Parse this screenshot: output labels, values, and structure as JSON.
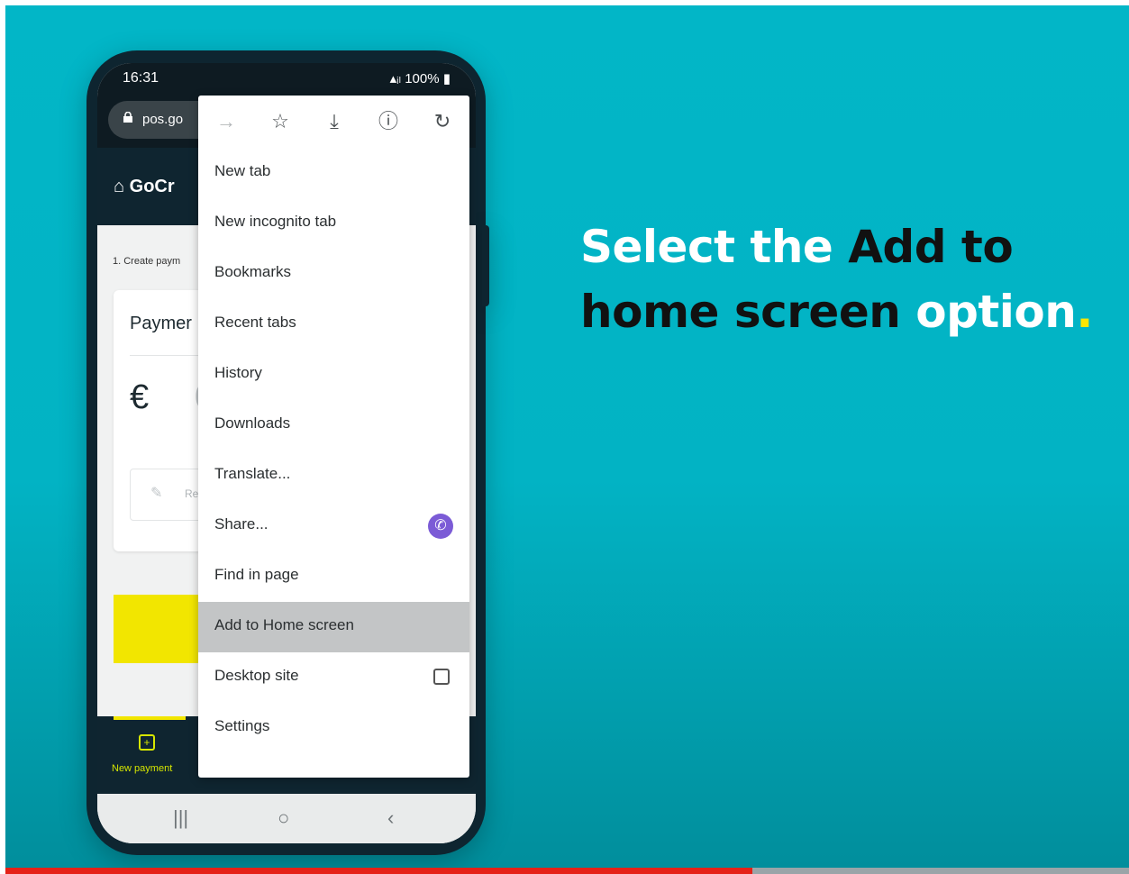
{
  "headline": {
    "part1": "Select the ",
    "part2": "Add to",
    "part3": "home screen ",
    "part4": "option",
    "part5": "."
  },
  "status_bar": {
    "time": "16:31",
    "battery": "100%"
  },
  "url_bar": {
    "text": "pos.go"
  },
  "app": {
    "logo": "GoCr",
    "breadcrumb": "1. Create paym",
    "card_title": "Paymer",
    "currency": "€",
    "amount": "0",
    "reference_hint": "Re",
    "bottom_nav_label": "New payment"
  },
  "menu": {
    "toolbar_icons": [
      "forward-icon",
      "star-icon",
      "download-icon",
      "info-icon",
      "reload-icon"
    ],
    "items": [
      {
        "label": "New tab"
      },
      {
        "label": "New incognito tab"
      },
      {
        "label": "Bookmarks"
      },
      {
        "label": "Recent tabs"
      },
      {
        "label": "History"
      },
      {
        "label": "Downloads"
      },
      {
        "label": "Translate..."
      },
      {
        "label": "Share..."
      },
      {
        "label": "Find in page"
      },
      {
        "label": "Add to Home screen"
      },
      {
        "label": "Desktop site"
      },
      {
        "label": "Settings"
      }
    ],
    "highlighted": "Add to Home screen"
  },
  "video_progress": 0.665,
  "colors": {
    "background": "#02b6c7",
    "highlight": "#ffe600",
    "progress": "#e52117"
  }
}
